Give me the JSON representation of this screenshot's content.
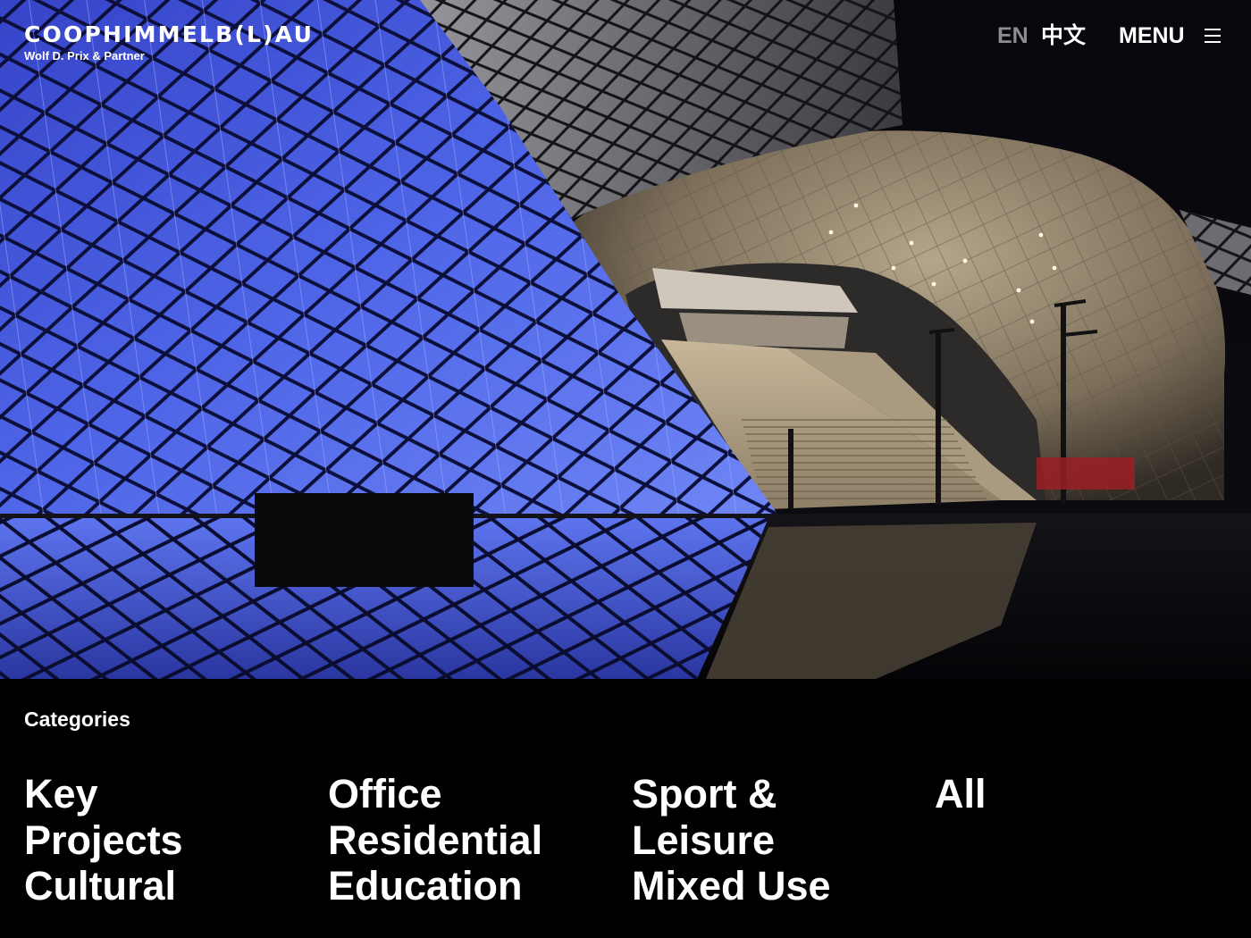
{
  "header": {
    "logo_name": "COOPHIMMELB(L)AU",
    "logo_subtitle": "Wolf D. Prix & Partner",
    "languages": [
      "EN",
      "中文"
    ],
    "active_language": "EN",
    "menu_label": "MENU",
    "menu_icon": "hamburger-icon"
  },
  "hero": {
    "description": "Night view of a building with a blue-lit diamond-grid glass facade, a golden-lit domed interior with stairs, reflected in water"
  },
  "categories": {
    "heading": "Categories",
    "columns": [
      [
        "Key\nProjects",
        "Cultural"
      ],
      [
        "Office",
        "Residential",
        "Education"
      ],
      [
        "Sport &\nLeisure",
        "Mixed Use"
      ],
      [
        "All"
      ]
    ]
  },
  "colors": {
    "background": "#000000",
    "text": "#ffffff",
    "inactive_language": "#8d8d8d",
    "facade_blue": "#4a5fe0",
    "interior_gold": "#8a7a60"
  }
}
